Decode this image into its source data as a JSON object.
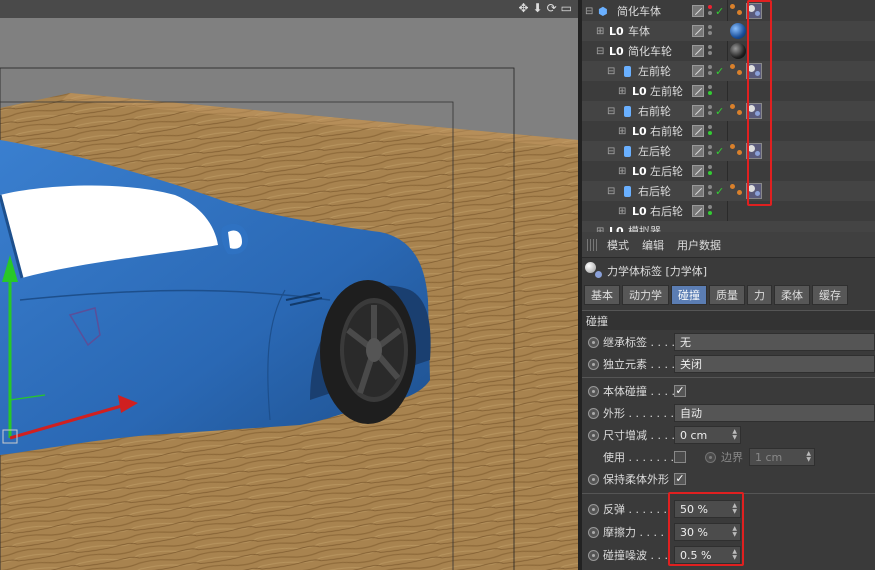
{
  "object_manager": {
    "rows": [
      {
        "label": "简化车体",
        "icon": "cube-icon"
      },
      {
        "label": "车体",
        "icon": "null-object-icon"
      },
      {
        "label": "简化车轮",
        "icon": "null-object-icon"
      },
      {
        "label": "左前轮",
        "icon": "cylinder-icon"
      },
      {
        "label": "左前轮",
        "icon": "null-object-icon"
      },
      {
        "label": "右前轮",
        "icon": "cylinder-icon"
      },
      {
        "label": "右前轮",
        "icon": "null-object-icon"
      },
      {
        "label": "左后轮",
        "icon": "cylinder-icon"
      },
      {
        "label": "左后轮",
        "icon": "null-object-icon"
      },
      {
        "label": "右后轮",
        "icon": "cylinder-icon"
      },
      {
        "label": "右后轮",
        "icon": "null-object-icon"
      },
      {
        "label": "模拟器",
        "icon": "null-object-icon"
      }
    ],
    "null_icon_text": "L0"
  },
  "attribute_manager": {
    "menu": [
      "模式",
      "编辑",
      "用户数据"
    ],
    "tag_title": "力学体标签 [力学体]",
    "tabs": [
      "基本",
      "动力学",
      "碰撞",
      "质量",
      "力",
      "柔体",
      "缓存"
    ],
    "active_tab": "碰撞",
    "section_title": "碰撞",
    "inherit_tag": {
      "label": "继承标签 . . . .",
      "value": "无"
    },
    "standalone": {
      "label": "独立元素 . . . .",
      "value": "关闭"
    },
    "self_collision": {
      "label": "本体碰撞 . . . .",
      "checked": "✓"
    },
    "shape": {
      "label": "外形 . . . . . . .",
      "value": "自动"
    },
    "size_increment": {
      "label": "尺寸增减 . . . .",
      "value": "0 cm"
    },
    "use": {
      "label": "使用 . . . . . . . .",
      "checked": ""
    },
    "margin": {
      "label": "边界",
      "value": "1 cm"
    },
    "keep_soft_shape": {
      "label": "保持柔体外形",
      "checked": "✓"
    },
    "bounce": {
      "label": "反弹 . . . . . .",
      "value": "50 %"
    },
    "friction": {
      "label": "摩擦力 . . . . .",
      "value": "30 %"
    },
    "collision_noise": {
      "label": "碰撞噪波 . . .",
      "value": "0.5 %"
    }
  },
  "colors": {
    "highlight": "#e02020",
    "active_tab": "#5b7db3",
    "car_blue": "#2a68b4"
  }
}
